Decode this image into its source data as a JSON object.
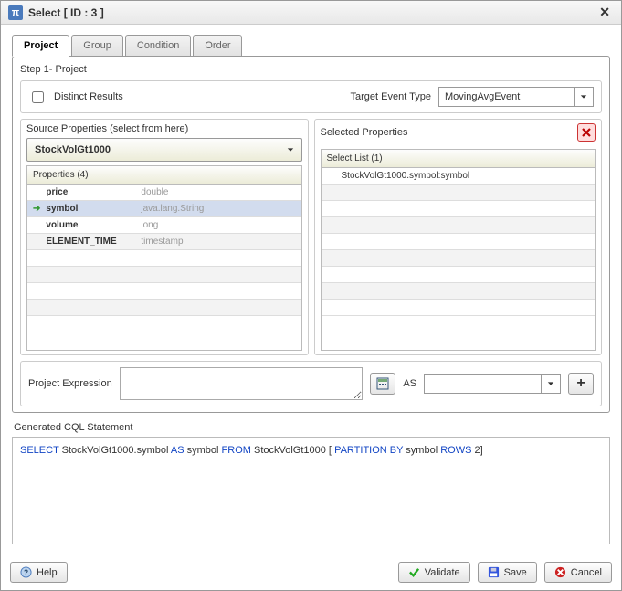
{
  "window": {
    "title": "Select [ ID : 3 ]"
  },
  "tabs": [
    {
      "label": "Project",
      "active": true
    },
    {
      "label": "Group",
      "active": false
    },
    {
      "label": "Condition",
      "active": false
    },
    {
      "label": "Order",
      "active": false
    }
  ],
  "step_title": "Step 1- Project",
  "distinct": {
    "label": "Distinct Results",
    "checked": false
  },
  "target_event": {
    "label": "Target Event Type",
    "value": "MovingAvgEvent"
  },
  "source": {
    "title": "Source Properties (select from here)",
    "combo_value": "StockVolGt1000",
    "grid_header": "Properties (4)",
    "rows": [
      {
        "name": "price",
        "type": "double",
        "selected": false
      },
      {
        "name": "symbol",
        "type": "java.lang.String",
        "selected": true
      },
      {
        "name": "volume",
        "type": "long",
        "selected": false
      },
      {
        "name": "ELEMENT_TIME",
        "type": "timestamp",
        "selected": false
      }
    ]
  },
  "selected": {
    "title": "Selected Properties",
    "grid_header": "Select List (1)",
    "rows": [
      {
        "text": "StockVolGt1000.symbol:symbol"
      }
    ]
  },
  "expr": {
    "label": "Project Expression",
    "as_label": "AS"
  },
  "cql": {
    "label": "Generated CQL Statement",
    "tokens": [
      {
        "t": "SELECT",
        "kw": true
      },
      {
        "t": " StockVolGt1000.symbol ",
        "kw": false
      },
      {
        "t": "AS",
        "kw": true
      },
      {
        "t": " symbol ",
        "kw": false
      },
      {
        "t": "FROM",
        "kw": true
      },
      {
        "t": " StockVolGt1000  [ ",
        "kw": false
      },
      {
        "t": "PARTITION BY",
        "kw": true
      },
      {
        "t": " symbol  ",
        "kw": false
      },
      {
        "t": "ROWS",
        "kw": true
      },
      {
        "t": " 2]",
        "kw": false
      }
    ]
  },
  "buttons": {
    "help": "Help",
    "validate": "Validate",
    "save": "Save",
    "cancel": "Cancel"
  }
}
